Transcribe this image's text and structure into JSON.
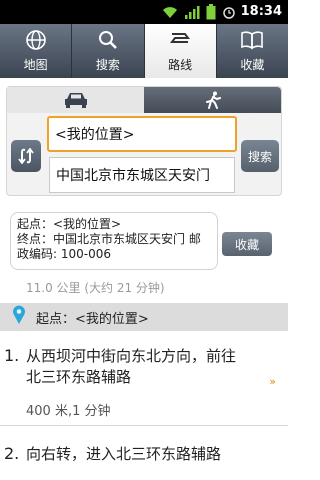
{
  "status_bar": {
    "time": "18:34"
  },
  "tabs": [
    {
      "label": "地图",
      "icon": "globe-icon"
    },
    {
      "label": "搜索",
      "icon": "search-icon"
    },
    {
      "label": "路线",
      "icon": "route-icon"
    },
    {
      "label": "收藏",
      "icon": "book-icon"
    }
  ],
  "active_tab": "路线",
  "planner": {
    "from_value": "<我的位置>",
    "to_value": "中国北京市东城区天安门",
    "search_label": "搜索",
    "modes": [
      "car-icon",
      "walk-icon"
    ]
  },
  "summary": {
    "start_line": "起点：<我的位置>",
    "end_line": "终点：中国北京市东城区天安门 邮政编码: 100-006",
    "save_label": "收藏",
    "distance": "11.0 公里 (大约 21 分钟)"
  },
  "start_row": {
    "label": "起点：<我的位置>"
  },
  "steps": [
    {
      "number": "1.",
      "text": "从西坝河中街向东北方向，前往北三环东路辅路",
      "sub": "400 米,1 分钟"
    },
    {
      "number": "2.",
      "text": "向右转，进入北三环东路辅路"
    }
  ],
  "colors": {
    "accent": "#f0a12a",
    "tab_bar": "#4b5562",
    "pin": "#2aa7d8"
  }
}
